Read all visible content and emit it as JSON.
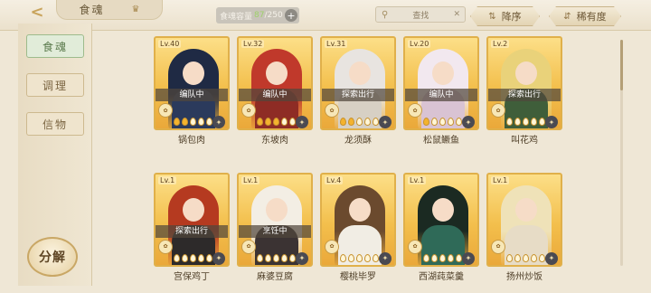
{
  "header": {
    "title": "食魂",
    "capacity_label": "食魂容量",
    "capacity_current": "87",
    "capacity_max": "/250",
    "search_placeholder": "查找",
    "sort_label": "降序",
    "rarity_label": "稀有度"
  },
  "sidebar": {
    "tabs": [
      {
        "label": "食魂",
        "active": true
      },
      {
        "label": "调理",
        "active": false
      },
      {
        "label": "信物",
        "active": false
      }
    ],
    "decompose_label": "分解"
  },
  "colors": {
    "card_gold": "#f3bf4c",
    "accent_green": "#9dbb8c",
    "status_bar": "#504640"
  },
  "cards": [
    {
      "level": "Lv.40",
      "name": "锅包肉",
      "status": "编队中",
      "stars_filled": 2,
      "hair": "#1f2a44",
      "cloth": "#2b3a5c"
    },
    {
      "level": "Lv.32",
      "name": "东坡肉",
      "status": "编队中",
      "stars_filled": 3,
      "hair": "#c0392b",
      "cloth": "#8e2c25"
    },
    {
      "level": "Lv.31",
      "name": "龙须酥",
      "status": "探索出行",
      "stars_filled": 2,
      "hair": "#e8e4e0",
      "cloth": "#d7d0c4"
    },
    {
      "level": "Lv.20",
      "name": "松鼠鳜鱼",
      "status": "编队中",
      "stars_filled": 1,
      "hair": "#f2e8ef",
      "cloth": "#d9c3d3"
    },
    {
      "level": "Lv.2",
      "name": "叫花鸡",
      "status": "探索出行",
      "stars_filled": 0,
      "hair": "#e9d27a",
      "cloth": "#3f5e3a"
    },
    {
      "level": "Lv.1",
      "name": "宫保鸡丁",
      "status": "探索出行",
      "stars_filled": 0,
      "hair": "#b53a20",
      "cloth": "#2d2a2a"
    },
    {
      "level": "Lv.1",
      "name": "麻婆豆腐",
      "status": "烹饪中",
      "stars_filled": 0,
      "hair": "#f3eee4",
      "cloth": "#3b3333"
    },
    {
      "level": "Lv.4",
      "name": "樱桃毕罗",
      "status": "",
      "stars_filled": 0,
      "hair": "#6b4a2e",
      "cloth": "#f1ede4"
    },
    {
      "level": "Lv.1",
      "name": "西湖莼菜羹",
      "status": "",
      "stars_filled": 0,
      "hair": "#1b2a22",
      "cloth": "#2f6a58"
    },
    {
      "level": "Lv.1",
      "name": "扬州炒饭",
      "status": "",
      "stars_filled": 0,
      "hair": "#efe2b8",
      "cloth": "#e7dcc6"
    }
  ]
}
